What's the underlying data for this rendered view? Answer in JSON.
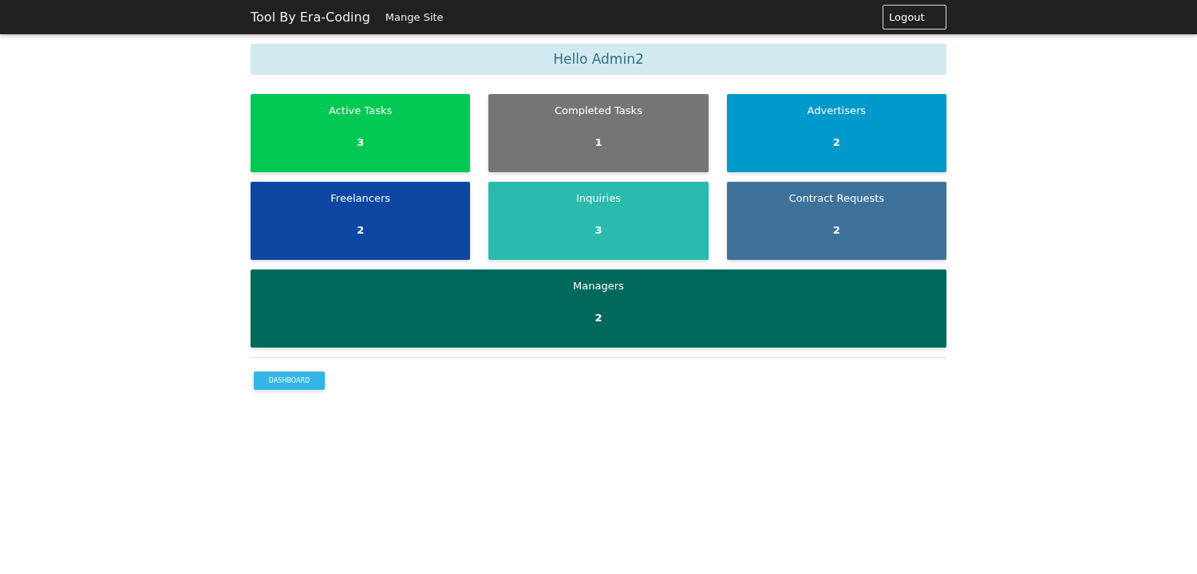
{
  "navbar": {
    "brand": "Tool By Era-Coding",
    "links": [
      "Mange Site"
    ],
    "logout": "Logout"
  },
  "greeting": "Hello Admin2",
  "cards": [
    {
      "label": "Active Tasks",
      "count": "3",
      "color": "#00c853"
    },
    {
      "label": "Completed Tasks",
      "count": "1",
      "color": "#757575"
    },
    {
      "label": "Advertisers",
      "count": "2",
      "color": "#0099cc"
    },
    {
      "label": "Freelancers",
      "count": "2",
      "color": "#0d47a1"
    },
    {
      "label": "Inquiries",
      "count": "3",
      "color": "#2bbbad"
    },
    {
      "label": "Contract Requests",
      "count": "2",
      "color": "#3f729b"
    },
    {
      "label": "Managers",
      "count": "2",
      "color": "#00695c"
    }
  ],
  "dashboard_button": "DASHBOARD"
}
